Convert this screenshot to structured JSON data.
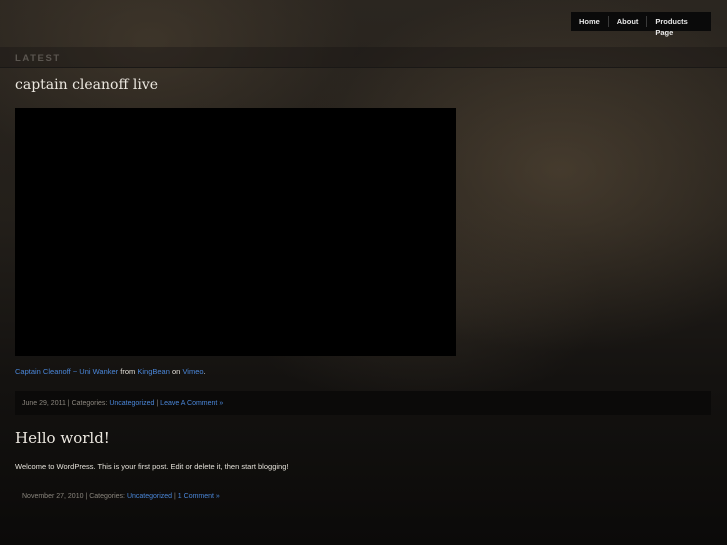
{
  "nav": {
    "items": [
      {
        "label": "Home"
      },
      {
        "label": "About"
      },
      {
        "label": "Products Page"
      }
    ]
  },
  "section_label": "LATEST",
  "posts": [
    {
      "title": "captain cleanoff live",
      "caption": {
        "link1": "Captain Cleanoff ~ Uni Wanker",
        "text1": "from",
        "link2": "KingBean",
        "text2": "on",
        "link3": "Vimeo",
        "text3": "."
      },
      "meta": {
        "date": "June 29, 2011",
        "sep1": " | Categories: ",
        "category": "Uncategorized",
        "sep2": " | ",
        "comments": "Leave A Comment »"
      }
    },
    {
      "title": "Hello world!",
      "body": "Welcome to WordPress. This is your first post. Edit or delete it, then start blogging!",
      "meta": {
        "date": "November 27, 2010",
        "sep1": " | Categories: ",
        "category": "Uncategorized",
        "sep2": " | ",
        "comments": "1 Comment »"
      }
    }
  ]
}
